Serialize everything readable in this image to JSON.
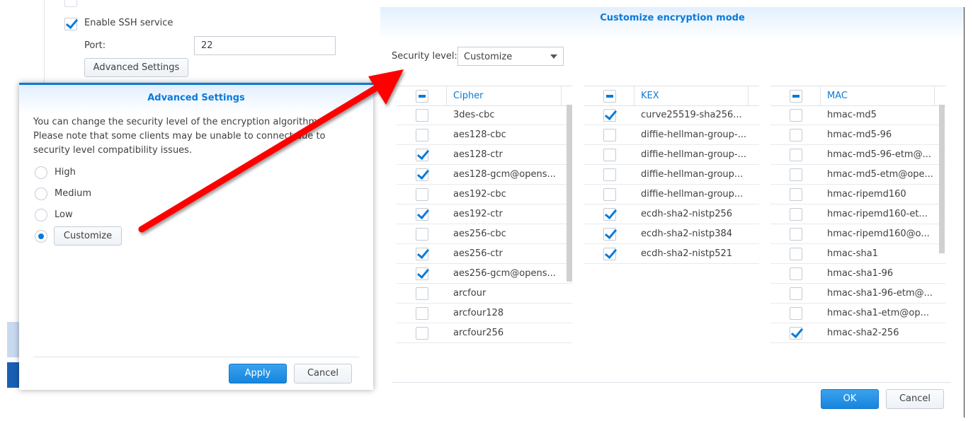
{
  "background": {
    "ssh_label": "Enable SSH service",
    "ssh_enabled": true,
    "port_label": "Port:",
    "port_value": "22",
    "advanced_button": "Advanced Settings"
  },
  "advanced_dialog": {
    "title": "Advanced Settings",
    "description": "You can change the security level of the encryption algorithm. Please note that some clients may be unable to connect due to security level compatibility issues.",
    "options": [
      {
        "label": "High",
        "selected": false
      },
      {
        "label": "Medium",
        "selected": false
      },
      {
        "label": "Low",
        "selected": false
      },
      {
        "label": "Customize",
        "selected": true
      }
    ],
    "apply": "Apply",
    "cancel": "Cancel"
  },
  "customize_dialog": {
    "title": "Customize encryption mode",
    "security_label": "Security level:",
    "security_value": "Customize",
    "ok": "OK",
    "cancel": "Cancel",
    "columns": [
      {
        "header": "Cipher",
        "items": [
          {
            "name": "3des-cbc",
            "checked": false
          },
          {
            "name": "aes128-cbc",
            "checked": false
          },
          {
            "name": "aes128-ctr",
            "checked": true
          },
          {
            "name": "aes128-gcm@opens...",
            "checked": true
          },
          {
            "name": "aes192-cbc",
            "checked": false
          },
          {
            "name": "aes192-ctr",
            "checked": true
          },
          {
            "name": "aes256-cbc",
            "checked": false
          },
          {
            "name": "aes256-ctr",
            "checked": true
          },
          {
            "name": "aes256-gcm@opens...",
            "checked": true
          },
          {
            "name": "arcfour",
            "checked": false
          },
          {
            "name": "arcfour128",
            "checked": false
          },
          {
            "name": "arcfour256",
            "checked": false
          }
        ]
      },
      {
        "header": "KEX",
        "items": [
          {
            "name": "curve25519-sha256...",
            "checked": true
          },
          {
            "name": "diffie-hellman-group-...",
            "checked": false
          },
          {
            "name": "diffie-hellman-group-...",
            "checked": false
          },
          {
            "name": "diffie-hellman-group...",
            "checked": false
          },
          {
            "name": "diffie-hellman-group...",
            "checked": false
          },
          {
            "name": "ecdh-sha2-nistp256",
            "checked": true
          },
          {
            "name": "ecdh-sha2-nistp384",
            "checked": true
          },
          {
            "name": "ecdh-sha2-nistp521",
            "checked": true
          }
        ]
      },
      {
        "header": "MAC",
        "items": [
          {
            "name": "hmac-md5",
            "checked": false
          },
          {
            "name": "hmac-md5-96",
            "checked": false
          },
          {
            "name": "hmac-md5-96-etm@...",
            "checked": false
          },
          {
            "name": "hmac-md5-etm@ope...",
            "checked": false
          },
          {
            "name": "hmac-ripemd160",
            "checked": false
          },
          {
            "name": "hmac-ripemd160-et...",
            "checked": false
          },
          {
            "name": "hmac-ripemd160@o...",
            "checked": false
          },
          {
            "name": "hmac-sha1",
            "checked": false
          },
          {
            "name": "hmac-sha1-96",
            "checked": false
          },
          {
            "name": "hmac-sha1-96-etm@...",
            "checked": false
          },
          {
            "name": "hmac-sha1-etm@op...",
            "checked": false
          },
          {
            "name": "hmac-sha2-256",
            "checked": true
          }
        ]
      }
    ]
  },
  "colors": {
    "accent": "#0a7ad8",
    "arrow": "#ff0000"
  }
}
